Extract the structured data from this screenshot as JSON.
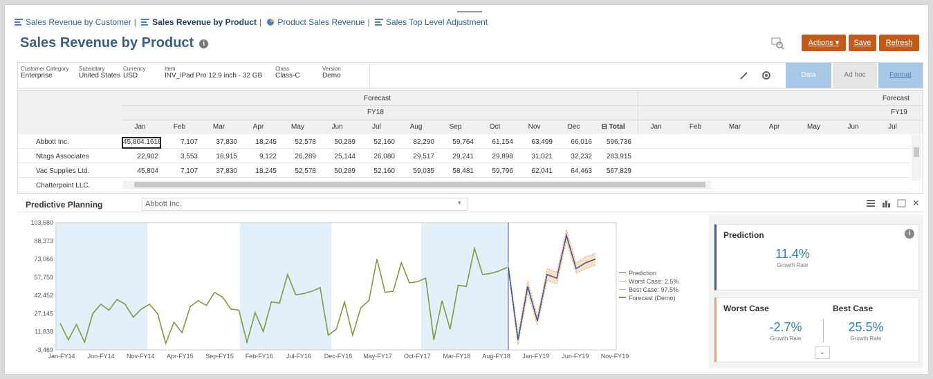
{
  "breadcrumbs": [
    {
      "label": "Sales Revenue by Customer",
      "current": false
    },
    {
      "label": "Sales Revenue by Product",
      "current": true
    },
    {
      "label": "Product Sales Revenue",
      "current": false
    },
    {
      "label": "Sales Top Level Adjustment",
      "current": false
    }
  ],
  "page_title": "Sales Revenue by Product",
  "toolbar": {
    "actions": "Actions",
    "save": "Save",
    "refresh": "Refresh"
  },
  "pov": [
    {
      "label": "Customer Category",
      "value": "Enterprise"
    },
    {
      "label": "Subsidiary",
      "value": "United States"
    },
    {
      "label": "Currency",
      "value": "USD"
    },
    {
      "label": "Item",
      "value": "INV_iPad Pro 12.9 inch - 32 GB"
    },
    {
      "label": "Class",
      "value": "Class-C"
    },
    {
      "label": "Version",
      "value": "Demo"
    }
  ],
  "view_tabs": {
    "data": "Data",
    "adhoc": "Ad hoc",
    "format": "Format"
  },
  "grid": {
    "scenario1": "Forecast",
    "year1": "FY18",
    "scenario2": "Forecast",
    "year2": "FY19",
    "months1": [
      "Jan",
      "Feb",
      "Mar",
      "Apr",
      "May",
      "Jun",
      "Jul",
      "Aug",
      "Sep",
      "Oct",
      "Nov",
      "Dec",
      "Total"
    ],
    "months2": [
      "Jan",
      "Feb",
      "Mar",
      "Apr",
      "May",
      "Jun",
      "Jul"
    ],
    "rows": [
      {
        "name": "Abbott Inc.",
        "values": [
          "45,804.1618",
          "7,107",
          "37,830",
          "18,245",
          "52,578",
          "50,289",
          "52,160",
          "82,290",
          "59,764",
          "61,154",
          "63,499",
          "66,016",
          "596,736"
        ]
      },
      {
        "name": "Ntags Associates",
        "values": [
          "22,902",
          "3,553",
          "18,915",
          "9,122",
          "26,289",
          "25,144",
          "26,080",
          "29,517",
          "29,241",
          "29,898",
          "31,021",
          "32,232",
          "283,915"
        ]
      },
      {
        "name": "Vac Supplies Ltd.",
        "values": [
          "45,804",
          "7,107",
          "37,830",
          "18,245",
          "52,578",
          "50,289",
          "52,160",
          "59,035",
          "58,481",
          "59,796",
          "62,041",
          "64,463",
          "567,829"
        ]
      },
      {
        "name": "Chatterpoint LLC.",
        "values": []
      }
    ]
  },
  "predictive": {
    "title": "Predictive Planning",
    "member": "Abbott Inc.",
    "legend": [
      "Prediction",
      "Worst Case: 2.5%",
      "Best Case: 97.5%",
      "Forecast (Demo)"
    ],
    "prediction_title": "Prediction",
    "prediction_value": "11.4%",
    "growth_rate": "Growth Rate",
    "worst_title": "Worst Case",
    "worst_value": "-2.7%",
    "best_title": "Best Case",
    "best_value": "25.5%"
  },
  "chart_data": {
    "type": "line",
    "yticks": [
      "103,680",
      "88,373",
      "73,066",
      "57,759",
      "42,452",
      "27,145",
      "11,838",
      "-3,469"
    ],
    "ylim": [
      -3469,
      103680
    ],
    "xticks": [
      "Jan-FY14",
      "Jun-FY14",
      "Nov-FY14",
      "Apr-FY15",
      "Sep-FY15",
      "Feb-FY16",
      "Jul-FY16",
      "Dec-FY16",
      "May-FY17",
      "Oct-FY17",
      "Mar-FY18",
      "Aug-FY18",
      "Jan-FY19",
      "Jun-FY19",
      "Nov-FY19"
    ],
    "series": [
      {
        "name": "Forecast (Demo)",
        "color": "#7f9a3f",
        "values": [
          19000,
          5000,
          18000,
          3000,
          27000,
          35000,
          30000,
          39000,
          35000,
          24000,
          31000,
          35000,
          27000,
          2000,
          20000,
          11000,
          33000,
          38000,
          34000,
          45000,
          41000,
          31000,
          30000,
          3000,
          28000,
          12000,
          37000,
          36000,
          60000,
          43000,
          44000,
          46000,
          49000,
          9000,
          14000,
          37000,
          9000,
          32000,
          38000,
          73000,
          45000,
          46000,
          70000,
          53000,
          54000,
          57000,
          5000,
          38000,
          14000,
          51000,
          50000,
          82000,
          60000,
          61000,
          63000,
          66000
        ]
      },
      {
        "name": "Prediction",
        "color": "#3c5a9a",
        "values": [
          66000,
          5000,
          50000,
          21000,
          60000,
          57000,
          93000,
          65000,
          70000,
          73000
        ]
      },
      {
        "name": "Worst Case: 2.5%",
        "color": "#f0a060",
        "values": [
          63000,
          1000,
          45000,
          17000,
          55000,
          52000,
          88000,
          61000,
          65000,
          68000
        ]
      },
      {
        "name": "Best Case: 97.5%",
        "color": "#f0a060",
        "values": [
          70000,
          9000,
          55000,
          25000,
          65000,
          62000,
          98000,
          70000,
          75000,
          78000
        ]
      }
    ]
  }
}
